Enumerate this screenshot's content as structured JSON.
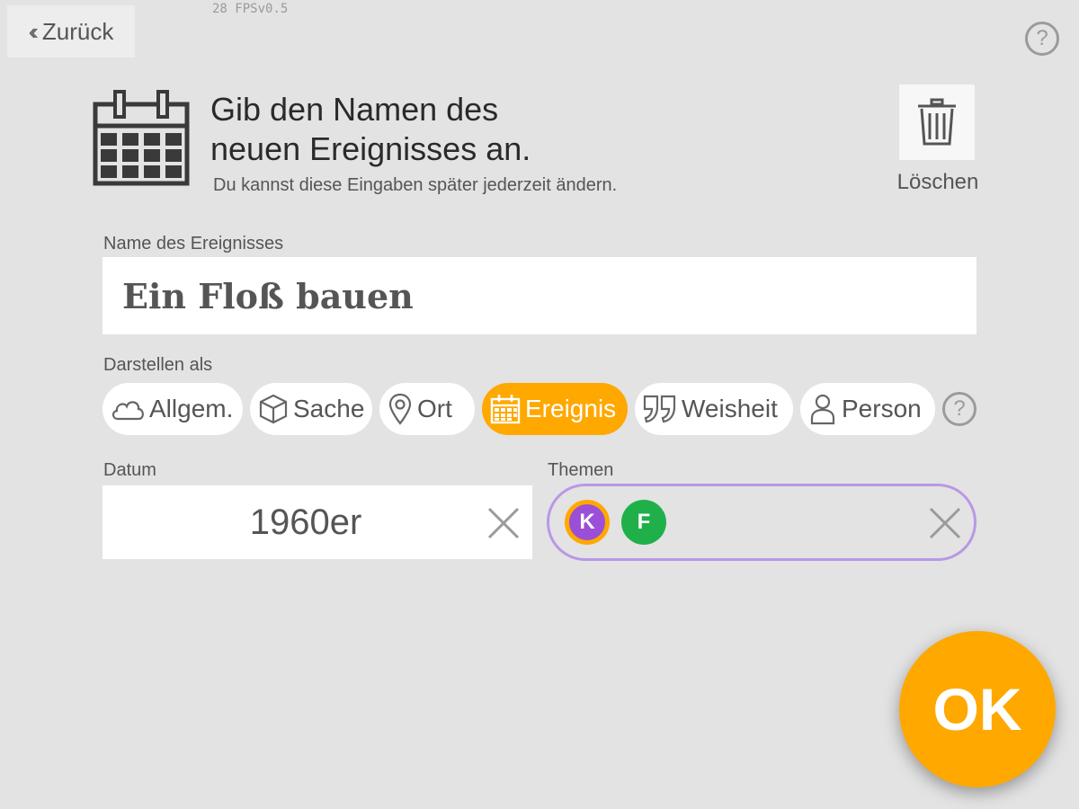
{
  "debug": {
    "fps_text": "28 FPSv0.5"
  },
  "nav": {
    "back_label": "Zurück"
  },
  "help": {
    "symbol": "?"
  },
  "header": {
    "title_line1": "Gib den Namen des",
    "title_line2": "neuen Ereignisses an.",
    "subtitle": "Du kannst diese Eingaben später jederzeit ändern.",
    "icon": "calendar-icon"
  },
  "delete": {
    "label": "Löschen",
    "icon": "trash-icon"
  },
  "name_field": {
    "label": "Name des Ereignisses",
    "value": "Ein Floß bauen"
  },
  "display_as": {
    "label": "Darstellen als",
    "options": [
      {
        "label": "Allgem.",
        "icon": "cloud-icon",
        "selected": false
      },
      {
        "label": "Sache",
        "icon": "cube-icon",
        "selected": false
      },
      {
        "label": "Ort",
        "icon": "location-pin-icon",
        "selected": false
      },
      {
        "label": "Ereignis",
        "icon": "calendar-icon",
        "selected": true
      },
      {
        "label": "Weisheit",
        "icon": "quote-icon",
        "selected": false
      },
      {
        "label": "Person",
        "icon": "person-icon",
        "selected": false
      }
    ]
  },
  "date_field": {
    "label": "Datum",
    "value": "1960er"
  },
  "themes_field": {
    "label": "Themen",
    "badges": [
      {
        "letter": "K",
        "color": "#9b4fd6",
        "ring": "#ffa800"
      },
      {
        "letter": "F",
        "color": "#1fb04a"
      }
    ]
  },
  "ok_button": {
    "label": "OK"
  },
  "colors": {
    "accent": "#ffa800",
    "background": "#e3e3e3",
    "themes_border": "#b898e6"
  }
}
